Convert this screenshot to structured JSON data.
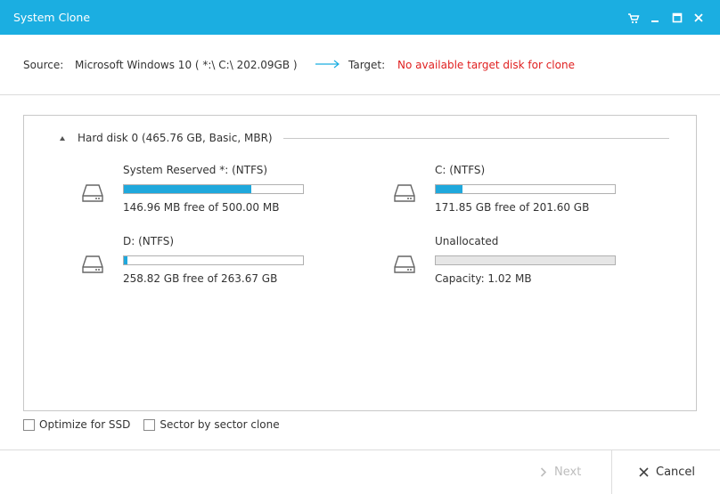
{
  "window": {
    "title": "System Clone",
    "controls": [
      "cart-icon",
      "minimize-icon",
      "maximize-icon",
      "close-icon"
    ]
  },
  "source_row": {
    "source_label": "Source:",
    "source_value": "Microsoft Windows 10 ( *:\\ C:\\  202.09GB )",
    "target_label": "Target:",
    "target_value": "No available target disk for clone",
    "target_color": "#e02020"
  },
  "disk": {
    "label": "Hard disk 0 (465.76 GB, Basic, MBR)",
    "partitions": [
      {
        "name": "System Reserved *: (NTFS)",
        "info": "146.96 MB free of 500.00 MB",
        "used_fraction": 0.71
      },
      {
        "name": "C: (NTFS)",
        "info": "171.85 GB free of 201.60 GB",
        "used_fraction": 0.15
      },
      {
        "name": "D: (NTFS)",
        "info": "258.82 GB free of 263.67 GB",
        "used_fraction": 0.02
      },
      {
        "name": "Unallocated",
        "info": "Capacity: 1.02 MB",
        "used_fraction": 0
      }
    ]
  },
  "options": {
    "optimize_ssd": "Optimize for SSD",
    "sector_clone": "Sector by sector clone"
  },
  "footer": {
    "next_label": "Next",
    "cancel_label": "Cancel"
  },
  "colors": {
    "accent": "#1baee1",
    "bar_fill": "#1fa8dc",
    "disabled_text": "#bdbdbd"
  }
}
